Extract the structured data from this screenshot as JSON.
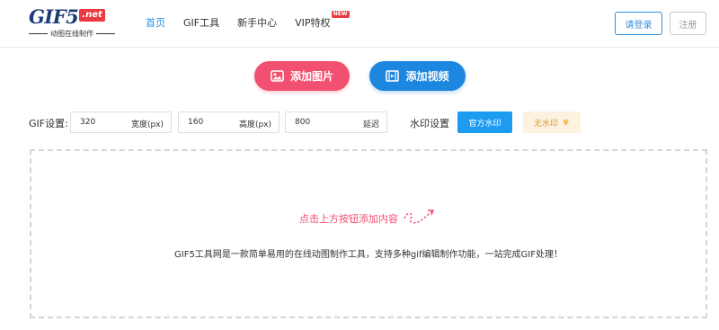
{
  "logo": {
    "main": "GIF5",
    "badge": ".net",
    "sub": "动图在线制作"
  },
  "nav": {
    "items": [
      {
        "label": "首页",
        "active": true
      },
      {
        "label": "GIF工具"
      },
      {
        "label": "新手中心"
      },
      {
        "label": "VIP特权",
        "badge": "NEW"
      }
    ]
  },
  "auth": {
    "login": "请登录",
    "register": "注册"
  },
  "actions": {
    "add_image": "添加图片",
    "add_video": "添加视频"
  },
  "settings": {
    "label": "GIF设置:",
    "width": {
      "value": "320",
      "unit": "宽度(px)"
    },
    "height": {
      "value": "160",
      "unit": "高度(px)"
    },
    "delay": {
      "value": "800",
      "unit": "延迟"
    }
  },
  "watermark": {
    "label": "水印设置",
    "official": "官方水印",
    "none": "无水印"
  },
  "dropzone": {
    "hint": "点击上方按钮添加内容",
    "description": "GIF5工具网是一款简单易用的在线动图制作工具，支持多种gif编辑制作功能，一站完成GIF处理！"
  },
  "colors": {
    "accent_blue": "#1d86de",
    "accent_pink": "#f25070",
    "badge_red": "#e83a40"
  },
  "icons": {
    "add_image": "image-icon",
    "add_video": "film-icon",
    "none_wm": "diamond-icon"
  }
}
